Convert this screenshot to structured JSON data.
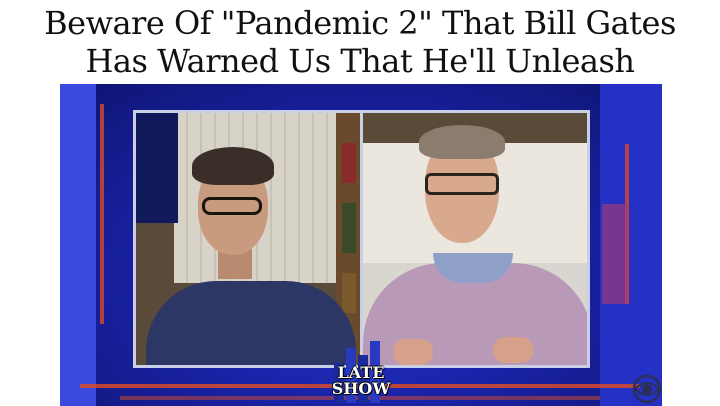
{
  "headline": {
    "line1": "Beware Of \"Pandemic 2\" That Bill Gates",
    "line2": "Has Warned Us That He'll Unleash"
  },
  "video": {
    "logo_line1": "LATE",
    "logo_line2": "SHOW",
    "network_icon": "cbs-eye-icon"
  },
  "colors": {
    "background": "#ffffff",
    "headline_text": "#111111",
    "stage_blue": "#1a23a8",
    "accent_red": "#d84a2a"
  }
}
